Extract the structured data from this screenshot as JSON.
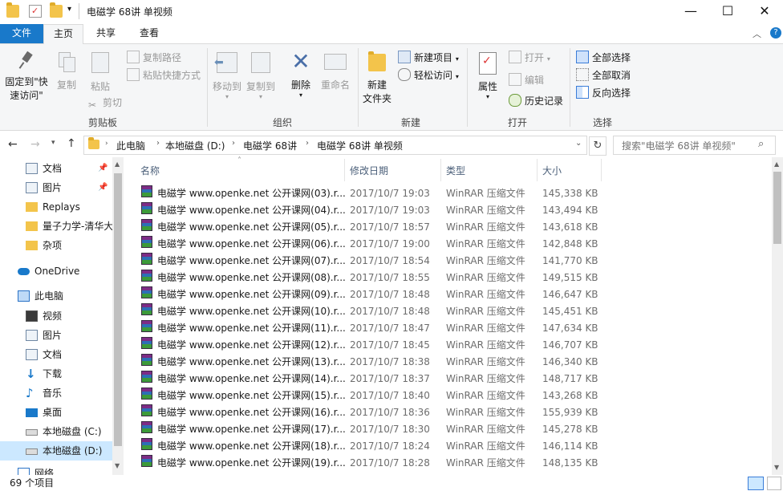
{
  "window": {
    "title": "电磁学 68讲 单视频",
    "minimize": "—",
    "maximize": "☐",
    "close": "✕"
  },
  "tabs": {
    "file": "文件",
    "home": "主页",
    "share": "共享",
    "view": "查看"
  },
  "ribbon": {
    "pin": "固定到\"快速访问\"",
    "pin_line1": "固定到\"快",
    "pin_line2": "速访问\"",
    "copy": "复制",
    "paste": "粘贴",
    "copy_path": "复制路径",
    "paste_shortcut": "粘贴快捷方式",
    "cut": "剪切",
    "group_clipboard": "剪贴板",
    "move_to": "移动到",
    "copy_to": "复制到",
    "delete": "删除",
    "rename": "重命名",
    "group_organize": "组织",
    "new_folder_l1": "新建",
    "new_folder_l2": "文件夹",
    "new_item": "新建项目",
    "easy_access": "轻松访问",
    "group_new": "新建",
    "properties": "属性",
    "open": "打开",
    "edit": "编辑",
    "history": "历史记录",
    "group_open": "打开",
    "select_all": "全部选择",
    "select_none": "全部取消",
    "invert": "反向选择",
    "group_select": "选择"
  },
  "address": {
    "crumbs": [
      "此电脑",
      "本地磁盘 (D:)",
      "电磁学 68讲",
      "电磁学 68讲 单视频"
    ],
    "search_placeholder": "搜索\"电磁学 68讲 单视频\""
  },
  "nav": {
    "items": [
      {
        "label": "文档",
        "icon": "document-icon"
      },
      {
        "label": "图片",
        "icon": "pictures-icon"
      },
      {
        "label": "Replays",
        "icon": "folder-icon"
      },
      {
        "label": "量子力学-清华大",
        "icon": "folder-icon"
      },
      {
        "label": "杂项",
        "icon": "folder-icon"
      },
      {
        "label": "OneDrive",
        "icon": "cloud-icon"
      },
      {
        "label": "此电脑",
        "icon": "computer-icon"
      },
      {
        "label": "视频",
        "icon": "video-icon"
      },
      {
        "label": "图片",
        "icon": "pictures-icon"
      },
      {
        "label": "文档",
        "icon": "document-icon"
      },
      {
        "label": "下载",
        "icon": "download-icon"
      },
      {
        "label": "音乐",
        "icon": "music-icon"
      },
      {
        "label": "桌面",
        "icon": "desktop-icon"
      },
      {
        "label": "本地磁盘 (C:)",
        "icon": "drive-icon"
      },
      {
        "label": "本地磁盘 (D:)",
        "icon": "drive-icon"
      },
      {
        "label": "网络",
        "icon": "network-icon"
      }
    ]
  },
  "columns": {
    "name": "名称",
    "date": "修改日期",
    "type": "类型",
    "size": "大小"
  },
  "files": [
    {
      "name": "电磁学 www.openke.net 公开课网(03).r...",
      "date": "2017/10/7 19:03",
      "type": "WinRAR 压缩文件",
      "size": "145,338 KB"
    },
    {
      "name": "电磁学 www.openke.net 公开课网(04).r...",
      "date": "2017/10/7 19:03",
      "type": "WinRAR 压缩文件",
      "size": "143,494 KB"
    },
    {
      "name": "电磁学 www.openke.net 公开课网(05).r...",
      "date": "2017/10/7 18:57",
      "type": "WinRAR 压缩文件",
      "size": "143,618 KB"
    },
    {
      "name": "电磁学 www.openke.net 公开课网(06).r...",
      "date": "2017/10/7 19:00",
      "type": "WinRAR 压缩文件",
      "size": "142,848 KB"
    },
    {
      "name": "电磁学 www.openke.net 公开课网(07).r...",
      "date": "2017/10/7 18:54",
      "type": "WinRAR 压缩文件",
      "size": "141,770 KB"
    },
    {
      "name": "电磁学 www.openke.net 公开课网(08).r...",
      "date": "2017/10/7 18:55",
      "type": "WinRAR 压缩文件",
      "size": "149,515 KB"
    },
    {
      "name": "电磁学 www.openke.net 公开课网(09).r...",
      "date": "2017/10/7 18:48",
      "type": "WinRAR 压缩文件",
      "size": "146,647 KB"
    },
    {
      "name": "电磁学 www.openke.net 公开课网(10).r...",
      "date": "2017/10/7 18:48",
      "type": "WinRAR 压缩文件",
      "size": "145,451 KB"
    },
    {
      "name": "电磁学 www.openke.net 公开课网(11).r...",
      "date": "2017/10/7 18:47",
      "type": "WinRAR 压缩文件",
      "size": "147,634 KB"
    },
    {
      "name": "电磁学 www.openke.net 公开课网(12).r...",
      "date": "2017/10/7 18:45",
      "type": "WinRAR 压缩文件",
      "size": "146,707 KB"
    },
    {
      "name": "电磁学 www.openke.net 公开课网(13).r...",
      "date": "2017/10/7 18:38",
      "type": "WinRAR 压缩文件",
      "size": "146,340 KB"
    },
    {
      "name": "电磁学 www.openke.net 公开课网(14).r...",
      "date": "2017/10/7 18:37",
      "type": "WinRAR 压缩文件",
      "size": "148,717 KB"
    },
    {
      "name": "电磁学 www.openke.net 公开课网(15).r...",
      "date": "2017/10/7 18:40",
      "type": "WinRAR 压缩文件",
      "size": "143,268 KB"
    },
    {
      "name": "电磁学 www.openke.net 公开课网(16).r...",
      "date": "2017/10/7 18:36",
      "type": "WinRAR 压缩文件",
      "size": "155,939 KB"
    },
    {
      "name": "电磁学 www.openke.net 公开课网(17).r...",
      "date": "2017/10/7 18:30",
      "type": "WinRAR 压缩文件",
      "size": "145,278 KB"
    },
    {
      "name": "电磁学 www.openke.net 公开课网(18).r...",
      "date": "2017/10/7 18:24",
      "type": "WinRAR 压缩文件",
      "size": "146,114 KB"
    },
    {
      "name": "电磁学 www.openke.net 公开课网(19).r...",
      "date": "2017/10/7 18:28",
      "type": "WinRAR 压缩文件",
      "size": "148,135 KB"
    }
  ],
  "status": {
    "count": "69 个项目"
  },
  "colors": {
    "accent": "#1979ca",
    "selected": "#cce8ff",
    "folder": "#f3c44b"
  }
}
